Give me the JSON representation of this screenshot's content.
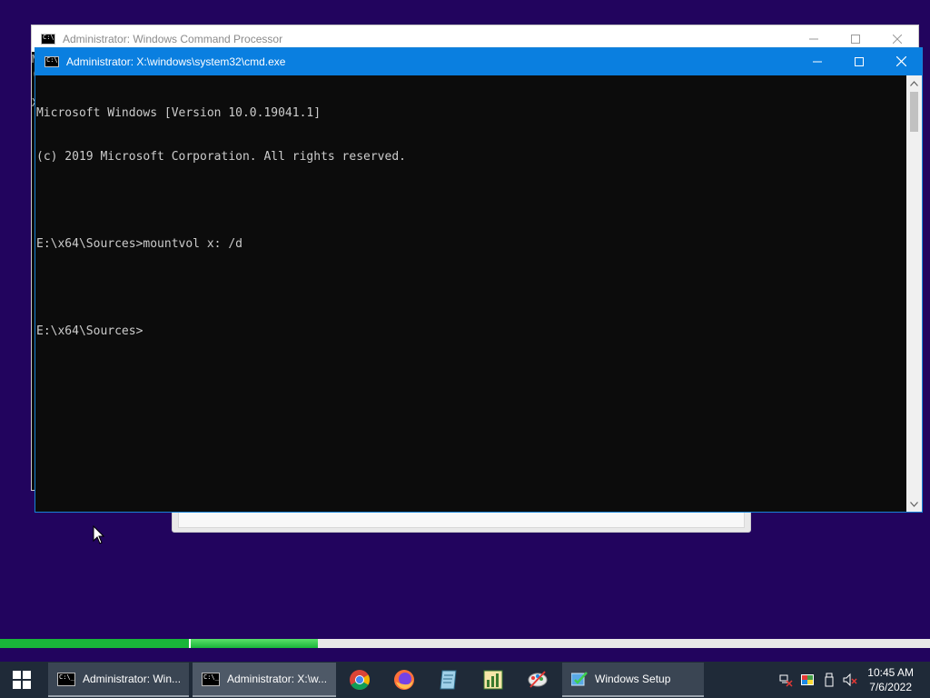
{
  "background_window": {
    "title": "Administrator: Windows Command Processor",
    "peek_chars": [
      "M",
      "(",
      "X"
    ]
  },
  "cmd_window": {
    "title": "Administrator: X:\\windows\\system32\\cmd.exe",
    "lines": [
      "Microsoft Windows [Version 10.0.19041.1]",
      "(c) 2019 Microsoft Corporation. All rights reserved.",
      "",
      "E:\\x64\\Sources>mountvol x: /d",
      "",
      "E:\\x64\\Sources>"
    ]
  },
  "progress": {
    "segment1_fraction": 0.2,
    "segment2_fraction": 0.14
  },
  "taskbar": {
    "items": [
      {
        "label": "Administrator: Win...",
        "state": "inactive",
        "icon": "cmd-icon"
      },
      {
        "label": "Administrator: X:\\w...",
        "state": "active",
        "icon": "cmd-icon"
      },
      {
        "label": "Windows Setup",
        "state": "inactive",
        "icon": "setup-icon"
      }
    ],
    "pinned": [
      "chrome-icon",
      "firefox-icon",
      "notepad-icon",
      "chart-icon",
      "paint-icon"
    ],
    "tray": [
      "network-icon",
      "color-icon",
      "usb-icon",
      "volume-muted-icon"
    ],
    "time": "10:45 AM",
    "date": "7/6/2022"
  },
  "colors": {
    "desktop": "#22045e",
    "titlebar_active": "#0a7fe0",
    "progress_green": "#19b53a",
    "taskbar": "#1f2a38"
  }
}
